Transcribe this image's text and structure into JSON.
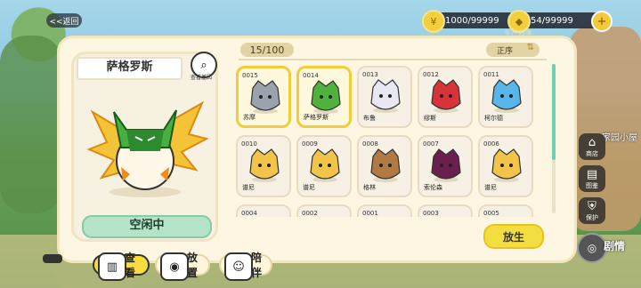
{
  "top_bar": {
    "back_label": "<<返回",
    "currency1": {
      "icon": "coin-icon",
      "value": "1000/99999"
    },
    "currency2": {
      "icon": "food-icon",
      "value": "54/99999"
    },
    "sub_label": "生产效率"
  },
  "detail": {
    "name": "萨格罗斯",
    "gene_label": "查看基因",
    "status": "空闲中"
  },
  "collection": {
    "count": "15/100",
    "sort_label": "正序",
    "items": [
      {
        "id": "0015",
        "name": "苏摩",
        "selected": true,
        "color": "#9aa3ad"
      },
      {
        "id": "0014",
        "name": "萨格罗斯",
        "selected": true,
        "color": "#4fb23c"
      },
      {
        "id": "0013",
        "name": "布鲁",
        "selected": false,
        "color": "#e8e8f2"
      },
      {
        "id": "0012",
        "name": "缪斯",
        "selected": false,
        "color": "#d7333a"
      },
      {
        "id": "0011",
        "name": "柯尔德",
        "selected": false,
        "color": "#57b6ea"
      },
      {
        "id": "0010",
        "name": "谱尼",
        "selected": false,
        "color": "#f2c54a"
      },
      {
        "id": "0009",
        "name": "谱尼",
        "selected": false,
        "color": "#f2c54a"
      },
      {
        "id": "0008",
        "name": "格林",
        "selected": false,
        "color": "#b07a45"
      },
      {
        "id": "0007",
        "name": "索伦森",
        "selected": false,
        "color": "#6a1f4f"
      },
      {
        "id": "0006",
        "name": "谱尼",
        "selected": false,
        "color": "#f2c54a"
      },
      {
        "id": "0004",
        "name": "",
        "selected": false,
        "color": "#f2c54a"
      },
      {
        "id": "0002",
        "name": "",
        "selected": false,
        "color": "#f2c54a"
      },
      {
        "id": "0001",
        "name": "",
        "selected": false,
        "color": "#e8e8f2"
      },
      {
        "id": "0003",
        "name": "",
        "selected": false,
        "color": "#f2c54a"
      },
      {
        "id": "0005",
        "name": "",
        "selected": false,
        "color": "#d7333a"
      }
    ],
    "release_label": "放生"
  },
  "tabs": [
    {
      "label": "查看",
      "icon": "book-icon",
      "active": true
    },
    {
      "label": "放置",
      "icon": "pet-icon",
      "active": false
    },
    {
      "label": "陪伴",
      "icon": "companion-icon",
      "active": false
    }
  ],
  "side_menu": {
    "home_label": "家园小屋",
    "items": [
      {
        "label": "商店",
        "icon": "shop-icon"
      },
      {
        "label": "图鉴",
        "icon": "book-icon"
      },
      {
        "label": "保护",
        "icon": "shield-icon"
      }
    ],
    "bottom_label": "剧情"
  }
}
